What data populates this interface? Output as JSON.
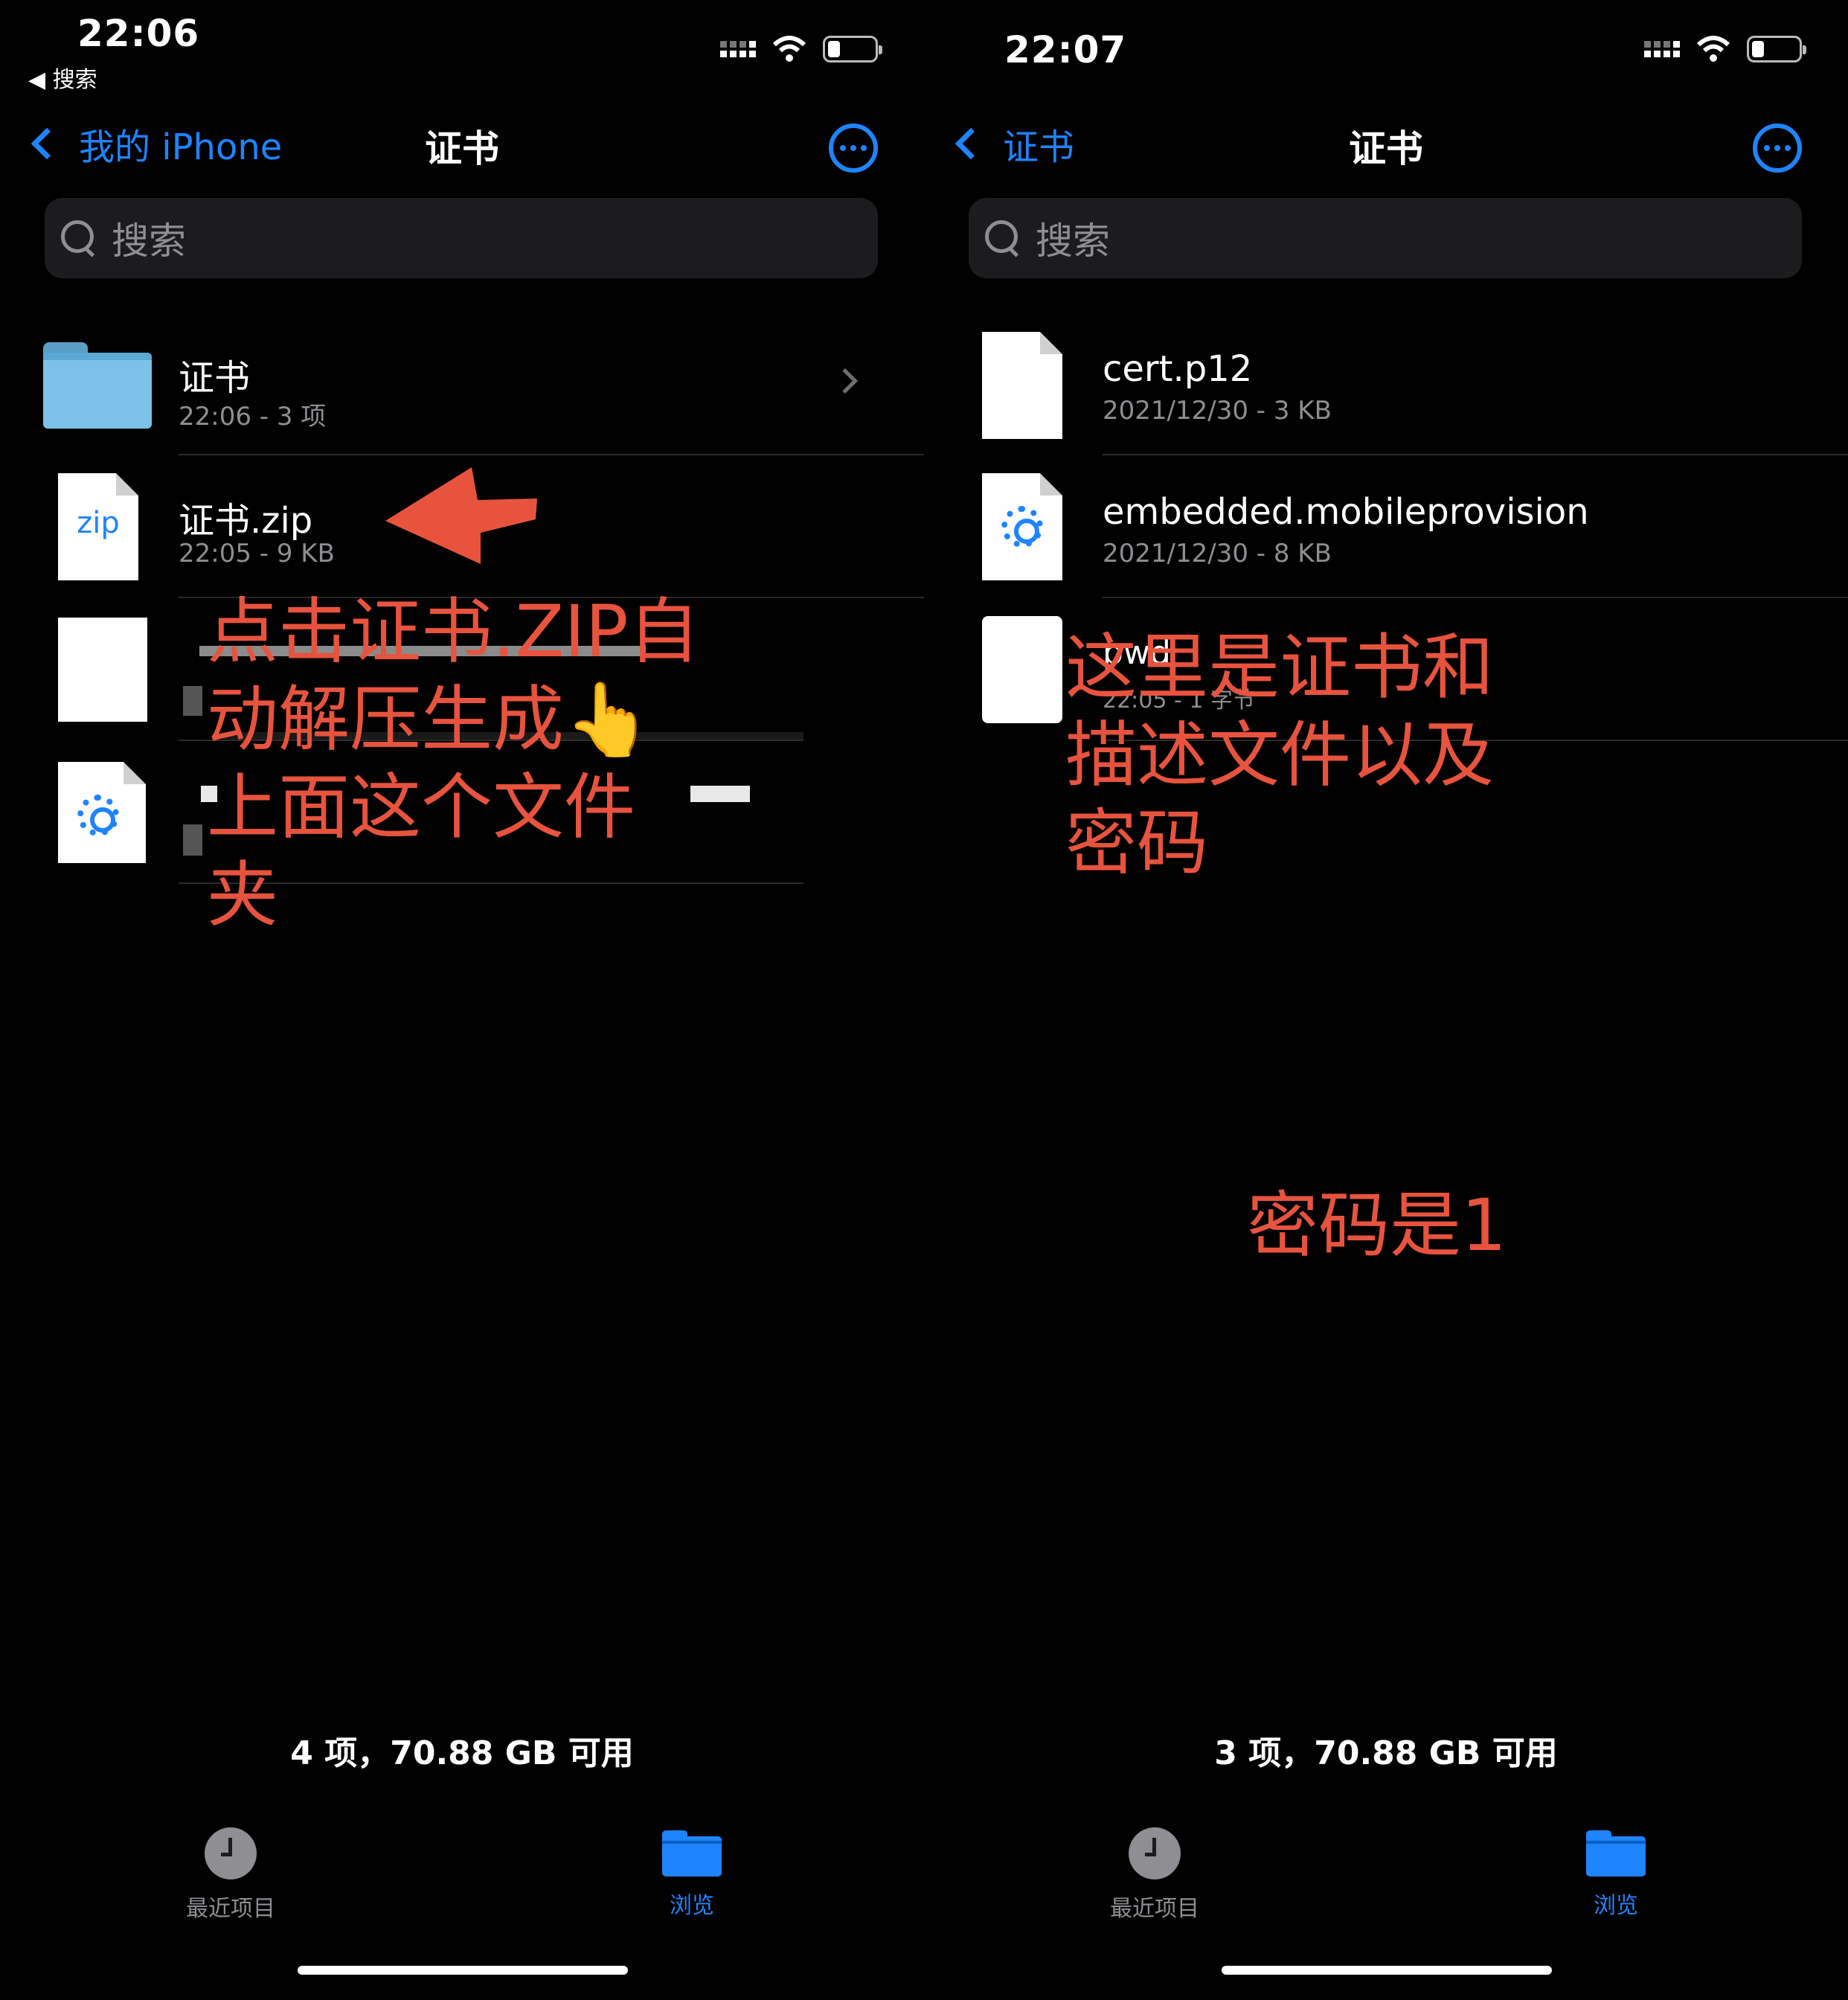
{
  "left": {
    "status": {
      "time": "22:06",
      "back_app": "◀ 搜索"
    },
    "nav": {
      "back_label": "我的 iPhone",
      "title": "证书"
    },
    "search": {
      "placeholder": "搜索"
    },
    "items": [
      {
        "name": "证书",
        "meta": "22:06 - 3 项",
        "icon": "folder-icon"
      },
      {
        "name": "证书.zip",
        "meta": "22:05 - 9 KB",
        "icon": "zip-file-icon",
        "icon_label": "zip"
      }
    ],
    "annotation": "点击证书.ZIP自动解压生成👆上面这个文件夹",
    "annotation_lines": [
      "点击证书.ZIP自",
      "动解压生成👆",
      "上面这个文件",
      "夹"
    ],
    "footer": "4 项，70.88 GB 可用",
    "tabs": [
      {
        "label": "最近项目",
        "icon": "clock-icon"
      },
      {
        "label": "浏览",
        "icon": "folder-icon",
        "active": true
      }
    ]
  },
  "right": {
    "status": {
      "time": "22:07"
    },
    "nav": {
      "back_label": "证书",
      "title": "证书"
    },
    "search": {
      "placeholder": "搜索"
    },
    "items": [
      {
        "name": "cert.p12",
        "meta": "2021/12/30 - 3 KB",
        "icon": "document-icon"
      },
      {
        "name": "embedded.mobileprovision",
        "meta": "2021/12/30 - 8 KB",
        "icon": "gear-document-icon"
      },
      {
        "name": "pwd",
        "meta": "22:05 - 1 字节",
        "icon": "document-icon"
      }
    ],
    "annotation_lines": [
      "这里是证书和",
      "描述文件以及",
      "密码"
    ],
    "annotation2": "密码是1",
    "footer": "3 项，70.88 GB 可用",
    "tabs": [
      {
        "label": "最近项目",
        "icon": "clock-icon"
      },
      {
        "label": "浏览",
        "icon": "folder-icon",
        "active": true
      }
    ]
  },
  "colors": {
    "accent": "#1e84ff",
    "annotation": "#e8533e",
    "background": "#000000",
    "secondary_text": "#8e8e93"
  }
}
